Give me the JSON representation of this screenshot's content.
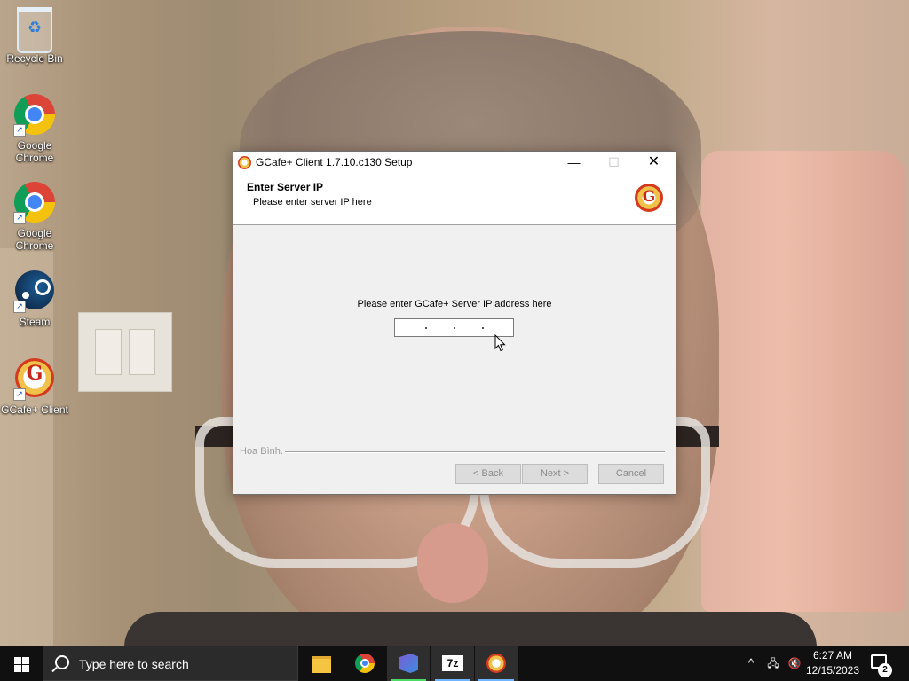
{
  "desktop": {
    "icons": [
      {
        "label": "Recycle Bin",
        "icon": "recycle-bin-icon"
      },
      {
        "label": "Google Chrome",
        "icon": "chrome-icon"
      },
      {
        "label": "Google Chrome",
        "icon": "chrome-icon"
      },
      {
        "label": "Steam",
        "icon": "steam-icon"
      },
      {
        "label": "GCafe+ Client",
        "icon": "gcafe-icon"
      }
    ]
  },
  "window": {
    "title": "GCafe+ Client 1.7.10.c130 Setup",
    "controls": {
      "minimize": "—",
      "maximize": "☐",
      "close": "✕"
    },
    "header_title": "Enter Server IP",
    "header_subtitle": "Please enter server IP here",
    "logo_glyph": "G",
    "prompt": "Please enter GCafe+ Server IP address here",
    "ip_value": ". . .",
    "branding": "Hoa Bình.",
    "buttons": {
      "back": "< Back",
      "next": "Next >",
      "cancel": "Cancel"
    }
  },
  "taskbar": {
    "search_placeholder": "Type here to search",
    "apps": [
      {
        "name": "file-explorer-icon",
        "active": false
      },
      {
        "name": "chrome-icon",
        "active": false
      },
      {
        "name": "visual-studio-icon",
        "active": true
      },
      {
        "name": "7zip-icon",
        "label": "7z",
        "active": true
      },
      {
        "name": "gcafe-icon",
        "active": true
      }
    ],
    "tray": {
      "chevron": "^",
      "network": "🖧",
      "volume": "🔇"
    },
    "time": "6:27 AM",
    "date": "12/15/2023",
    "notification_count": "2"
  },
  "colors": {
    "accent": "#6fb4ff",
    "taskbar": "#101010",
    "window_bg": "#f0f0f0"
  }
}
